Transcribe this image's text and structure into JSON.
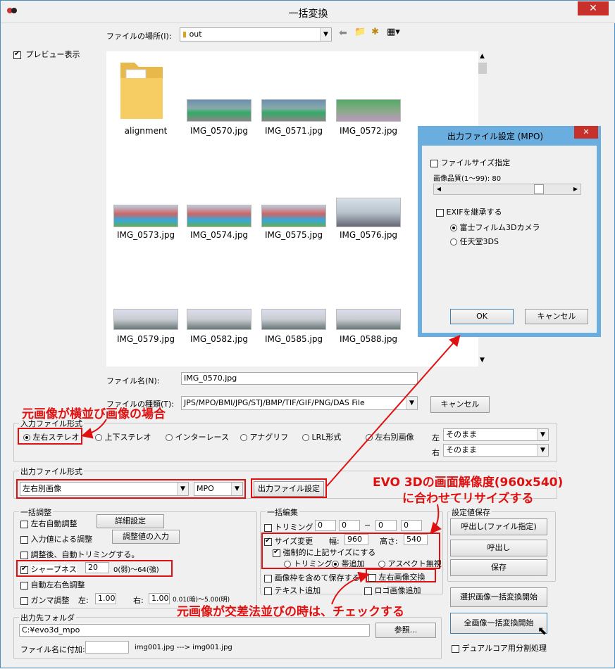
{
  "window": {
    "title": "一括変換",
    "close": "✕"
  },
  "location": {
    "label": "ファイルの場所(I):",
    "value": "out"
  },
  "preview": {
    "label": "プレビュー表示",
    "checked": true
  },
  "files": [
    {
      "name": "alignment",
      "type": "folder"
    },
    {
      "name": "IMG_0570.jpg"
    },
    {
      "name": "IMG_0571.jpg"
    },
    {
      "name": "IMG_0572.jpg"
    },
    {
      "name": "IMG_0573.jpg"
    },
    {
      "name": "IMG_0574.jpg"
    },
    {
      "name": "IMG_0575.jpg"
    },
    {
      "name": "IMG_0576.jpg"
    },
    {
      "name": "IMG_0579.jpg"
    },
    {
      "name": "IMG_0582.jpg"
    },
    {
      "name": "IMG_0585.jpg"
    },
    {
      "name": "IMG_0588.jpg"
    }
  ],
  "filename": {
    "label": "ファイル名(N):",
    "value": "IMG_0570.jpg"
  },
  "filetype": {
    "label": "ファイルの種類(T):",
    "value": "JPS/MPO/BMI/JPG/STJ/BMP/TIF/GIF/PNG/DAS File",
    "cancel": "キャンセル"
  },
  "input_format": {
    "label": "入力ファイル形式",
    "options": [
      "左右ステレオ",
      "上下ステレオ",
      "インターレース",
      "アナグリフ",
      "LRL形式",
      "左右別画像"
    ],
    "left_label": "左",
    "left_value": "そのまま",
    "right_label": "右",
    "right_value": "そのまま"
  },
  "output_format": {
    "label": "出力ファイル形式",
    "format": "左右別画像",
    "type": "MPO",
    "settings_btn": "出力ファイル設定"
  },
  "adjust": {
    "label": "一括調整",
    "auto_lr": "左右自動調整",
    "detail_btn": "詳細設定",
    "input_adjust": "入力値による調整",
    "adjust_input_btn": "調整値の入力",
    "auto_trim": "調整後、自動トリミングする。",
    "sharpness": "シャープネス",
    "sharp_value": "20",
    "sharp_range": "0(弱)〜64(強)",
    "auto_color": "自動左右色調整",
    "gamma": "ガンマ調整",
    "gamma_left_label": "左:",
    "gamma_left": "1.00",
    "gamma_right_label": "右:",
    "gamma_right": "1.00",
    "gamma_range": "0.01(暗)〜5.00(明)"
  },
  "edit": {
    "label": "一括編集",
    "trim": "トリミング",
    "trim_vals": [
      "0",
      "0",
      "0",
      "0"
    ],
    "trim_dash": "−",
    "resize": "サイズ変更",
    "width_label": "幅:",
    "width": "960",
    "height_label": "高さ:",
    "height": "540",
    "force": "強制的に上記サイズにする",
    "opt_trim": "トリミング",
    "opt_band": "帯追加",
    "opt_aspect": "アスペクト無視",
    "save_frame": "画像枠を含めて保存する",
    "swap": "左右画像交換",
    "text_add": "テキスト追加",
    "logo_add": "ロゴ画像追加"
  },
  "settings_save": {
    "label": "設定値保存",
    "load_file": "呼出し(ファイル指定)",
    "load": "呼出し",
    "save": "保存"
  },
  "actions": {
    "convert_selected": "選択画像一括変換開始",
    "convert_all": "全画像一括変換開始",
    "dual_core": "デュアルコア用分割処理"
  },
  "output_folder": {
    "label": "出力先フォルダ",
    "value": "C:¥evo3d_mpo",
    "browse": "参照...",
    "suffix_label": "ファイル名に付加:",
    "example": "img001.jpg ---> img001.jpg"
  },
  "mpo_dialog": {
    "title": "出力ファイル設定 (MPO)",
    "filesize": "ファイルサイズ指定",
    "quality": "画像品質(1〜99): 80",
    "quality_value": 80,
    "exif": "EXIFを継承する",
    "opt_fuji": "富士フィルム3Dカメラ",
    "opt_nintendo": "任天堂3DS",
    "ok": "OK",
    "cancel": "キャンセル"
  },
  "annotations": {
    "a1": "元画像が横並び画像の場合",
    "a2": "EVO 3Dの画面解像度(960x540)",
    "a3": "に合わせてリサイズする",
    "a4": "元画像が交差法並びの時は、チェックする"
  },
  "colors": {
    "annotation": "#e01010",
    "dialog_border": "#4a90c8"
  }
}
